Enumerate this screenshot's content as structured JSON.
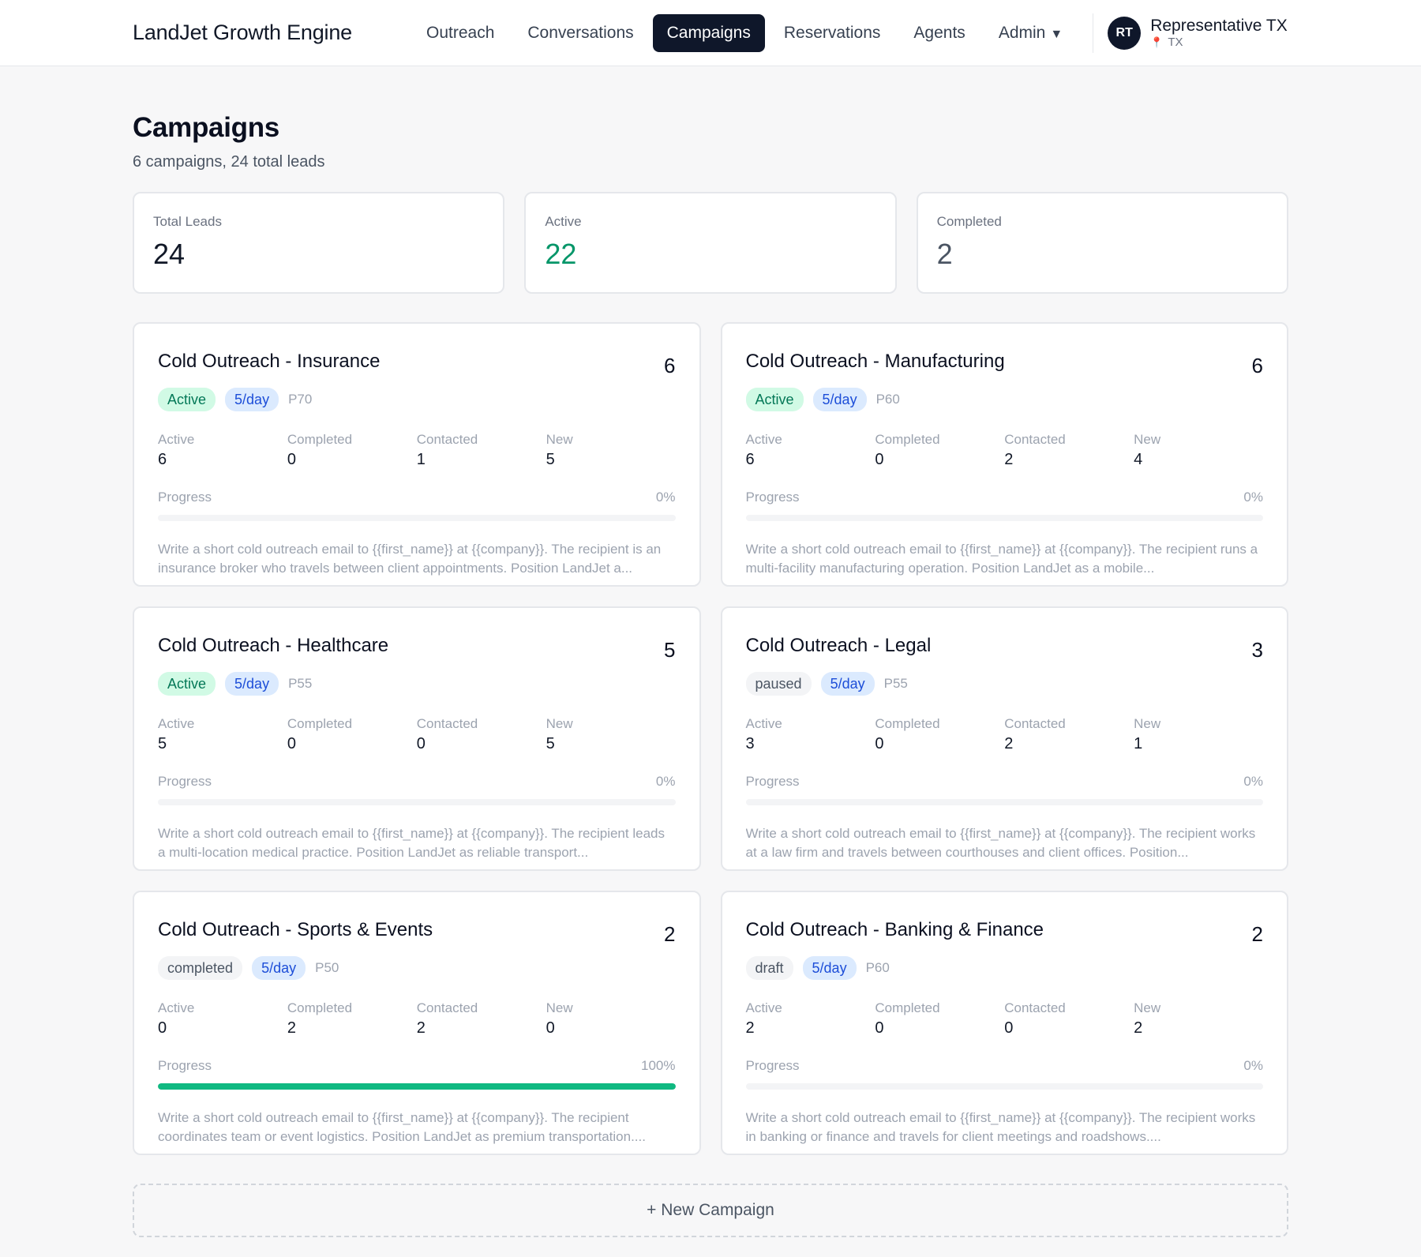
{
  "header": {
    "brand": "LandJet Growth Engine",
    "nav": [
      {
        "label": "Outreach",
        "active": false
      },
      {
        "label": "Conversations",
        "active": false
      },
      {
        "label": "Campaigns",
        "active": true
      },
      {
        "label": "Reservations",
        "active": false
      },
      {
        "label": "Agents",
        "active": false
      },
      {
        "label": "Admin",
        "active": false
      }
    ],
    "user": {
      "initials": "RT",
      "name": "Representative TX",
      "location": "TX"
    }
  },
  "page": {
    "title": "Campaigns",
    "subtitle": "6 campaigns, 24 total leads"
  },
  "stats": [
    {
      "label": "Total Leads",
      "value": "24",
      "color": "#111827"
    },
    {
      "label": "Active",
      "value": "22",
      "color": "#059669"
    },
    {
      "label": "Completed",
      "value": "2",
      "color": "#4b5563"
    }
  ],
  "metric_labels": {
    "active": "Active",
    "completed": "Completed",
    "contacted": "Contacted",
    "new": "New"
  },
  "progress_label": "Progress",
  "campaigns": [
    {
      "title": "Cold Outreach - Insurance",
      "count": "6",
      "status": "Active",
      "rate": "5/day",
      "priority": "P70",
      "metrics": {
        "active": "6",
        "completed": "0",
        "contacted": "1",
        "new": "5"
      },
      "progress": 0,
      "progress_text": "0%",
      "prompt": "Write a short cold outreach email to {{first_name}} at {{company}}. The recipient is an insurance broker who travels between client appointments. Position LandJet a..."
    },
    {
      "title": "Cold Outreach - Manufacturing",
      "count": "6",
      "status": "Active",
      "rate": "5/day",
      "priority": "P60",
      "metrics": {
        "active": "6",
        "completed": "0",
        "contacted": "2",
        "new": "4"
      },
      "progress": 0,
      "progress_text": "0%",
      "prompt": "Write a short cold outreach email to {{first_name}} at {{company}}. The recipient runs a multi-facility manufacturing operation. Position LandJet as a mobile..."
    },
    {
      "title": "Cold Outreach - Healthcare",
      "count": "5",
      "status": "Active",
      "rate": "5/day",
      "priority": "P55",
      "metrics": {
        "active": "5",
        "completed": "0",
        "contacted": "0",
        "new": "5"
      },
      "progress": 0,
      "progress_text": "0%",
      "prompt": "Write a short cold outreach email to {{first_name}} at {{company}}. The recipient leads a multi-location medical practice. Position LandJet as reliable transport..."
    },
    {
      "title": "Cold Outreach - Legal",
      "count": "3",
      "status": "paused",
      "rate": "5/day",
      "priority": "P55",
      "metrics": {
        "active": "3",
        "completed": "0",
        "contacted": "2",
        "new": "1"
      },
      "progress": 0,
      "progress_text": "0%",
      "prompt": "Write a short cold outreach email to {{first_name}} at {{company}}. The recipient works at a law firm and travels between courthouses and client offices. Position..."
    },
    {
      "title": "Cold Outreach - Sports & Events",
      "count": "2",
      "status": "completed",
      "rate": "5/day",
      "priority": "P50",
      "metrics": {
        "active": "0",
        "completed": "2",
        "contacted": "2",
        "new": "0"
      },
      "progress": 100,
      "progress_text": "100%",
      "prompt": "Write a short cold outreach email to {{first_name}} at {{company}}. The recipient coordinates team or event logistics. Position LandJet as premium transportation...."
    },
    {
      "title": "Cold Outreach - Banking & Finance",
      "count": "2",
      "status": "draft",
      "rate": "5/day",
      "priority": "P60",
      "metrics": {
        "active": "2",
        "completed": "0",
        "contacted": "0",
        "new": "2"
      },
      "progress": 0,
      "progress_text": "0%",
      "prompt": "Write a short cold outreach email to {{first_name}} at {{company}}. The recipient works in banking or finance and travels for client meetings and roadshows...."
    }
  ],
  "new_campaign_label": "+ New Campaign",
  "icons": {
    "caret": "caret-down-icon",
    "pin": "map-pin-icon"
  }
}
